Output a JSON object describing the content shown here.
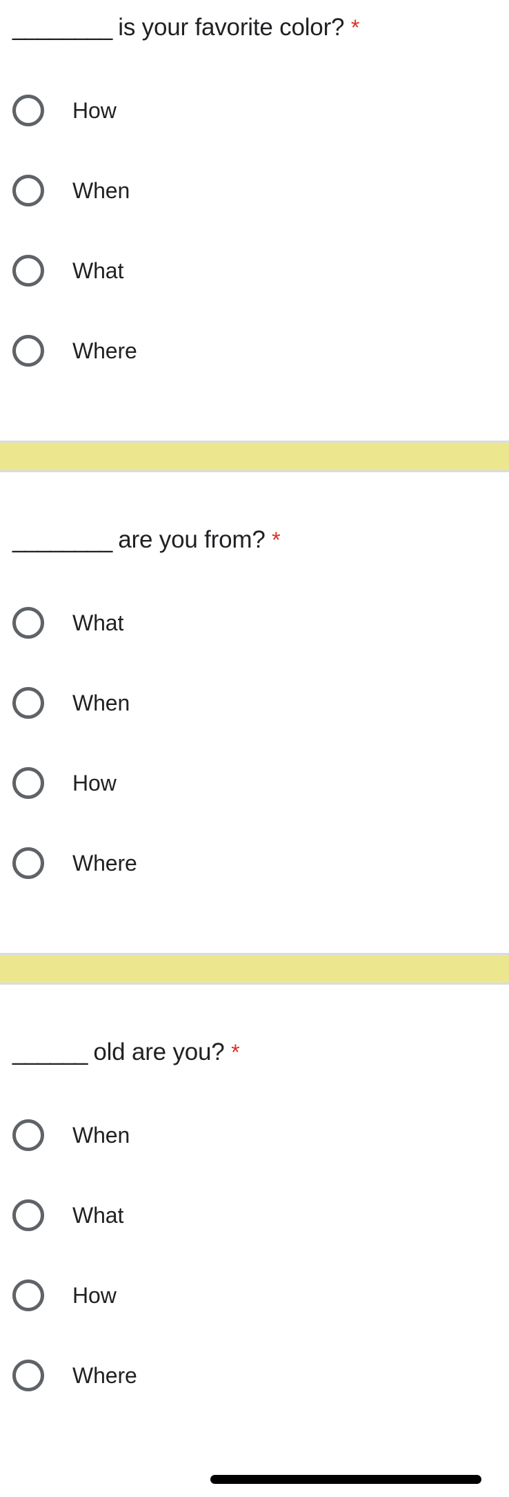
{
  "form": {
    "background_color": "#ffffff",
    "text_color": "#202124",
    "required_marker_color": "#d93025",
    "divider_color": "#ece78f",
    "divider_border_color": "#dadce0",
    "radio_border_color": "#5f6368",
    "required_marker": "*"
  },
  "questions": [
    {
      "blank": "________",
      "text": " is your favorite color? ",
      "required": true,
      "options": [
        {
          "label": "How",
          "selected": false
        },
        {
          "label": "When",
          "selected": false
        },
        {
          "label": "What",
          "selected": false
        },
        {
          "label": "Where",
          "selected": false
        }
      ]
    },
    {
      "blank": "________",
      "text": " are you from? ",
      "required": true,
      "options": [
        {
          "label": "What",
          "selected": false
        },
        {
          "label": "When",
          "selected": false
        },
        {
          "label": "How",
          "selected": false
        },
        {
          "label": "Where",
          "selected": false
        }
      ]
    },
    {
      "blank": "______",
      "text": " old are you? ",
      "required": true,
      "options": [
        {
          "label": "When",
          "selected": false
        },
        {
          "label": "What",
          "selected": false
        },
        {
          "label": "How",
          "selected": false
        },
        {
          "label": "Where",
          "selected": false
        }
      ]
    }
  ],
  "system_bar": {
    "home_indicator": true
  }
}
